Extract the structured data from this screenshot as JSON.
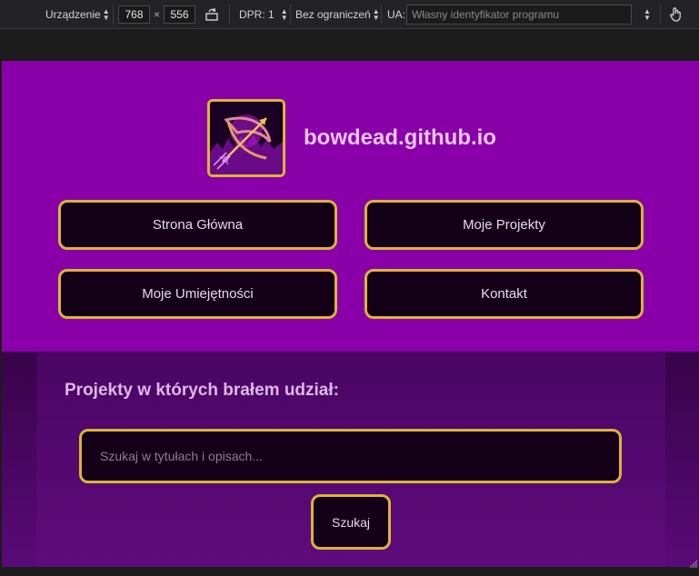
{
  "devtools": {
    "device_label": "Urządzenie",
    "width": "768",
    "times": "×",
    "height": "556",
    "dpr_label": "DPR: 1",
    "throttle_label": "Bez ograniczeń",
    "ua_label": "UA:",
    "ua_placeholder": "Własny identyfikator programu"
  },
  "site": {
    "name": "bowdead.github.io",
    "nav": [
      {
        "label": "Strona Główna"
      },
      {
        "label": "Moje Projekty"
      },
      {
        "label": "Moje Umiejętności"
      },
      {
        "label": "Kontakt"
      }
    ],
    "section_title": "Projekty w których brałem udział:",
    "search_placeholder": "Szukaj w tytułach i opisach...",
    "search_button": "Szukaj"
  },
  "colors": {
    "header_bg": "#8a00a8",
    "button_border": "#d9b636",
    "button_bg": "#140017"
  }
}
